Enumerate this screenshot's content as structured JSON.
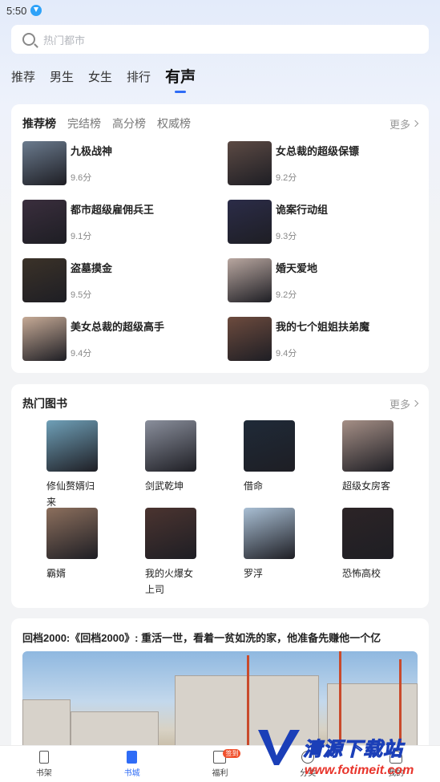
{
  "status_bar": {
    "time": "5:50"
  },
  "search": {
    "placeholder": "热门都市"
  },
  "tabs": [
    {
      "label": "推荐"
    },
    {
      "label": "男生"
    },
    {
      "label": "女生"
    },
    {
      "label": "排行"
    },
    {
      "label": "有声"
    }
  ],
  "ranking": {
    "tabs": [
      {
        "label": "推荐榜"
      },
      {
        "label": "完结榜"
      },
      {
        "label": "高分榜"
      },
      {
        "label": "权威榜"
      }
    ],
    "more_label": "更多",
    "items": [
      {
        "title": "九极战神",
        "score": "9.6分",
        "color": "#6b7b8e"
      },
      {
        "title": "女总裁的超级保镖",
        "score": "9.2分",
        "color": "#5c4a44"
      },
      {
        "title": "都市超级雇佣兵王",
        "score": "9.1分",
        "color": "#3a2e3d"
      },
      {
        "title": "诡案行动组",
        "score": "9.3分",
        "color": "#2b2c48"
      },
      {
        "title": "盗墓摸金",
        "score": "9.5分",
        "color": "#3b3228"
      },
      {
        "title": "婚天爱地",
        "score": "9.2分",
        "color": "#b9a7a0"
      },
      {
        "title": "美女总裁的超级高手",
        "score": "9.4分",
        "color": "#c6aa96"
      },
      {
        "title": "我的七个姐姐扶弟魔",
        "score": "9.4分",
        "color": "#6d4b3e"
      }
    ]
  },
  "hot_books": {
    "title": "热门图书",
    "more_label": "更多",
    "items": [
      {
        "title": "修仙赘婿归来",
        "color": "#6fa0b8"
      },
      {
        "title": "剑武乾坤",
        "color": "#8a8f9c"
      },
      {
        "title": "借命",
        "color": "#1f2a38"
      },
      {
        "title": "超级女房客",
        "color": "#a58f86"
      },
      {
        "title": "霸婿",
        "color": "#8c6f5d"
      },
      {
        "title": "我的火爆女上司",
        "color": "#4b3430"
      },
      {
        "title": "罗浮",
        "color": "#a9bfd4"
      },
      {
        "title": "恐怖高校",
        "color": "#2c2426"
      }
    ]
  },
  "news": {
    "title": "回档2000:《回档2000》: 重活一世，看着一贫如洗的家，他准备先赚他一个亿"
  },
  "bottom_nav": [
    {
      "label": "书架",
      "icon": "bookshelf-icon"
    },
    {
      "label": "书城",
      "icon": "bookstore-icon"
    },
    {
      "label": "福利",
      "icon": "gift-icon",
      "badge": "签到"
    },
    {
      "label": "分类",
      "icon": "category-icon"
    },
    {
      "label": "我的",
      "icon": "profile-icon"
    }
  ],
  "watermark": {
    "text": "清源下载站",
    "url": "www.fotimeit.com"
  }
}
